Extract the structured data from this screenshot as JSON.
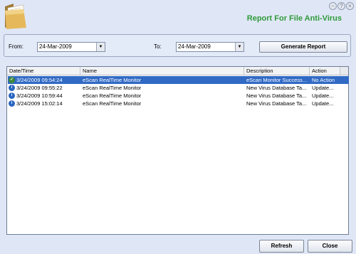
{
  "title": "Report For File Anti-Virus",
  "filters": {
    "from_label": "From:",
    "from_value": "24-Mar-2009",
    "to_label": "To:",
    "to_value": "24-Mar-2009",
    "generate_label": "Generate Report"
  },
  "table": {
    "columns": [
      "Date/Time",
      "Name",
      "Description",
      "Action"
    ],
    "rows": [
      {
        "icon": "check-icon",
        "datetime": "3/24/2009 09:54:24",
        "name": "eScan RealTime Monitor",
        "description": "eScan Monitor Success...",
        "action": "No Action",
        "selected": true
      },
      {
        "icon": "info-icon",
        "datetime": "3/24/2009 09:55:22",
        "name": "eScan RealTime Monitor",
        "description": "New Virus Database Ta...",
        "action": "Update...",
        "selected": false
      },
      {
        "icon": "info-icon",
        "datetime": "3/24/2009 10:59:44",
        "name": "eScan RealTime Monitor",
        "description": "New Virus Database Ta...",
        "action": "Update...",
        "selected": false
      },
      {
        "icon": "info-icon",
        "datetime": "3/24/2009 15:02:14",
        "name": "eScan RealTime Monitor",
        "description": "New Virus Database Ta...",
        "action": "Update...",
        "selected": false
      }
    ]
  },
  "footer": {
    "refresh_label": "Refresh",
    "close_label": "Close"
  },
  "icons": {
    "header": "folder-icon",
    "window_controls": [
      "minimize-icon",
      "help-icon",
      "close-icon"
    ]
  },
  "colors": {
    "title": "#2f9a3a",
    "selection": "#316ac5",
    "background": "#dfe7f6"
  }
}
